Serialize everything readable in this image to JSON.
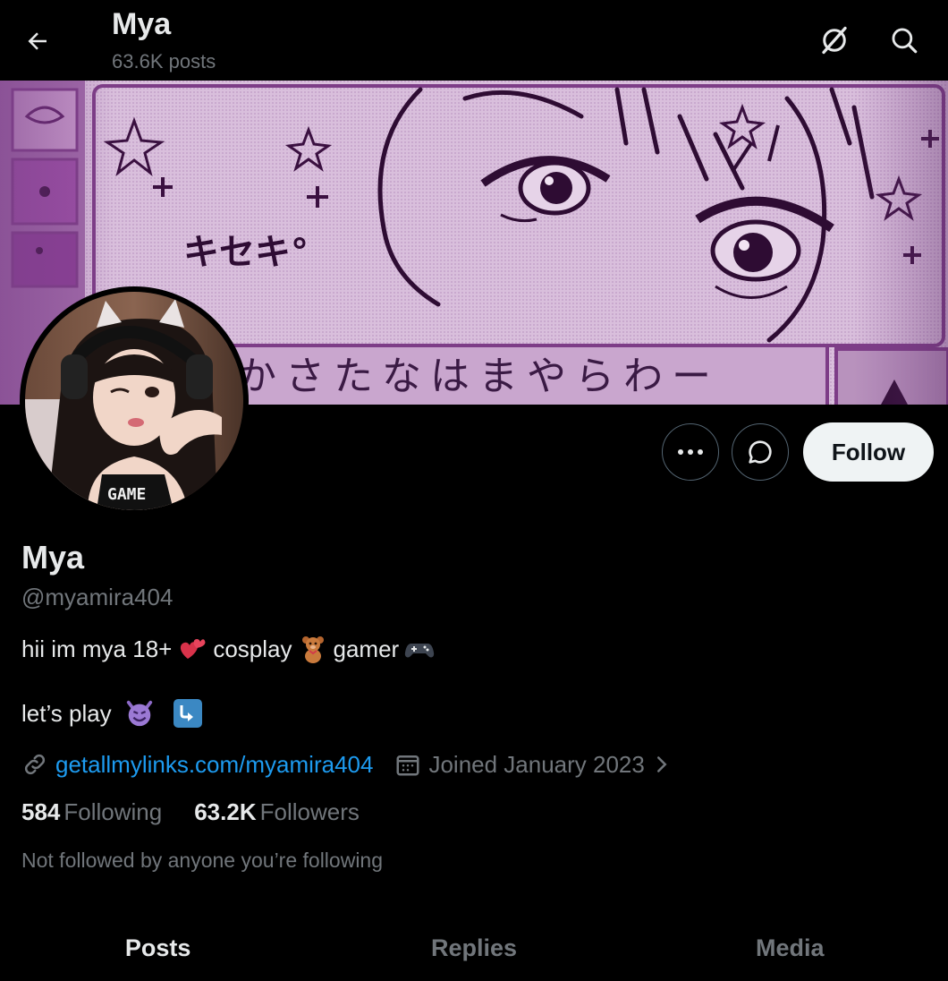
{
  "header": {
    "title": "Mya",
    "post_count": "63.6K posts",
    "back_icon": "arrow-left-icon",
    "grok_icon": "grok-icon",
    "search_icon": "search-icon"
  },
  "profile": {
    "display_name": "Mya",
    "handle": "@myamira404",
    "bio_line1": {
      "t1": "hii im mya 18+",
      "t2": "cosplay",
      "t3": "gamer"
    },
    "bio_line2": {
      "t1": "let’s play"
    },
    "website": "getallmylinks.com/myamira404",
    "joined": "Joined January 2023",
    "following_count": "584",
    "following_label": "Following",
    "followers_count": "63.2K",
    "followers_label": "Followers",
    "mutuals_text": "Not followed by anyone you’re following"
  },
  "actions": {
    "follow_label": "Follow"
  },
  "tabs": [
    {
      "label": "Posts",
      "active": true
    },
    {
      "label": "Replies",
      "active": false
    },
    {
      "label": "Media",
      "active": false
    }
  ],
  "colors": {
    "background": "#000000",
    "text_primary": "#e7e9ea",
    "text_secondary": "#71767b",
    "link": "#1d9bf0",
    "follow_bg": "#eff3f4",
    "banner_tint": "#c8a6cf"
  }
}
